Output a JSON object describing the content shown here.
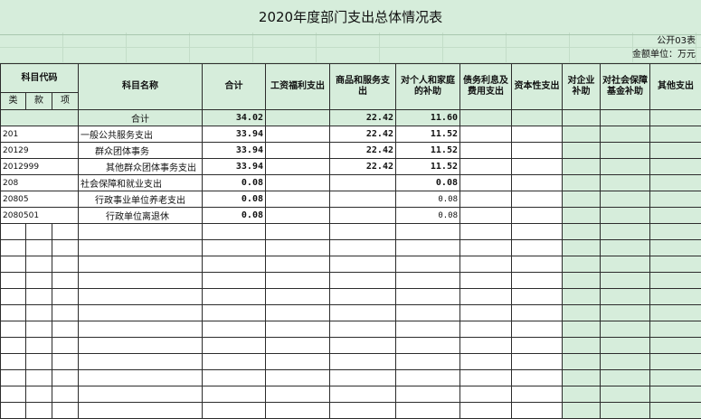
{
  "title": "2020年度部门支出总体情况表",
  "table_no": "公开03表",
  "unit": "金额单位：万元",
  "headers": {
    "code": "科目代码",
    "name": "科目名称",
    "total": "合计",
    "salary": "工资福利支出",
    "goods": "商品和服务支出",
    "personal": "对个人和家庭的补助",
    "debt": "债务利息及费用支出",
    "capital": "资本性支出",
    "enterprise": "对企业补助",
    "social": "对社会保障基金补助",
    "other": "其他支出",
    "lei": "类",
    "kuan": "款",
    "xiang": "项",
    "sum_label": "合计"
  },
  "totals": {
    "total": "34.02",
    "goods": "22.42",
    "personal": "11.60"
  },
  "rows": [
    {
      "code": "201",
      "name": "一般公共服务支出",
      "total": "33.94",
      "goods": "22.42",
      "personal": "11.52"
    },
    {
      "code": "20129",
      "name": "群众团体事务",
      "total": "33.94",
      "goods": "22.42",
      "personal": "11.52"
    },
    {
      "code": "2012999",
      "name": "其他群众团体事务支出",
      "total": "33.94",
      "goods": "22.42",
      "personal": "11.52"
    },
    {
      "code": "208",
      "name": "社会保障和就业支出",
      "total": "0.08",
      "goods": "",
      "personal": "0.08"
    },
    {
      "code": "20805",
      "name": "行政事业单位养老支出",
      "total": "0.08",
      "goods": "",
      "personal": "0.08"
    },
    {
      "code": "2080501",
      "name": "行政单位离退休",
      "total": "0.08",
      "goods": "",
      "personal": "0.08"
    }
  ]
}
